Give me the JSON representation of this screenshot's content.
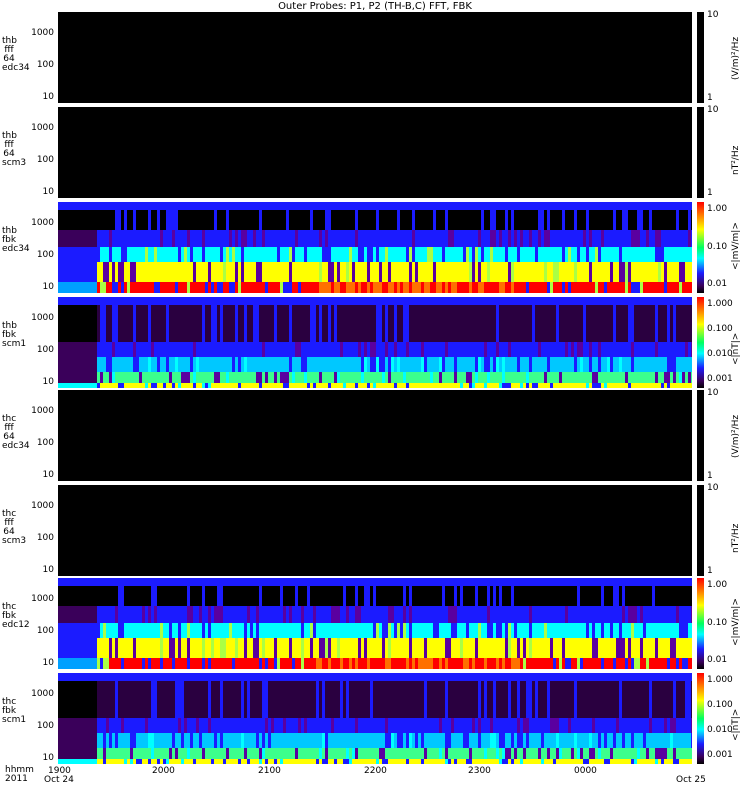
{
  "title": "Outer Probes: P1, P2 (TH-B,C) FFT, FBK",
  "footer": {
    "hhmm": "hhmm",
    "year": "2011"
  },
  "chart_data": [
    {
      "type": "heatmap",
      "panel_label": [
        "thb",
        "fff",
        "64",
        "edc34"
      ],
      "y_ticks": [
        "1000",
        "100",
        "10"
      ],
      "cbar_ticks": [
        "10",
        "1"
      ],
      "cbar_label": "(V/m)²/Hz",
      "empty": true
    },
    {
      "type": "heatmap",
      "panel_label": [
        "thb",
        "fff",
        "64",
        "scm3"
      ],
      "y_ticks": [
        "1000",
        "100",
        "10"
      ],
      "cbar_ticks": [
        "10",
        "1"
      ],
      "cbar_label": "nT²/Hz",
      "empty": true
    },
    {
      "type": "heatmap",
      "panel_label": [
        "thb",
        "fbk",
        "edc34"
      ],
      "y_ticks": [
        "1000",
        "100",
        "10"
      ],
      "cbar_ticks": [
        "1.00",
        "0.10",
        "0.01"
      ],
      "cbar_label": "<|mV/m|>",
      "empty": false
    },
    {
      "type": "heatmap",
      "panel_label": [
        "thb",
        "fbk",
        "scm1"
      ],
      "y_ticks": [
        "1000",
        "100",
        "10"
      ],
      "cbar_ticks": [
        "1.000",
        "0.100",
        "0.010",
        "0.001"
      ],
      "cbar_label": "<|nT|>",
      "empty": false
    },
    {
      "type": "heatmap",
      "panel_label": [
        "thc",
        "fff",
        "64",
        "edc34"
      ],
      "y_ticks": [
        "1000",
        "100",
        "10"
      ],
      "cbar_ticks": [
        "10",
        "1"
      ],
      "cbar_label": "(V/m)²/Hz",
      "empty": true
    },
    {
      "type": "heatmap",
      "panel_label": [
        "thc",
        "fff",
        "64",
        "scm3"
      ],
      "y_ticks": [
        "1000",
        "100",
        "10"
      ],
      "cbar_ticks": [
        "10",
        "1"
      ],
      "cbar_label": "nT²/Hz",
      "empty": true
    },
    {
      "type": "heatmap",
      "panel_label": [
        "thc",
        "fbk",
        "edc12"
      ],
      "y_ticks": [
        "1000",
        "100",
        "10"
      ],
      "cbar_ticks": [
        "1.00",
        "0.10",
        "0.01"
      ],
      "cbar_label": "<|mV/m|>",
      "empty": false
    },
    {
      "type": "heatmap",
      "panel_label": [
        "thc",
        "fbk",
        "scm1"
      ],
      "y_ticks": [
        "1000",
        "100",
        "10"
      ],
      "cbar_ticks": [
        "1.000",
        "0.100",
        "0.010",
        "0.001"
      ],
      "cbar_label": "<|nT|>",
      "empty": false
    }
  ],
  "x_axis": {
    "ticks": [
      "1900",
      "1900",
      "2000",
      "2100",
      "2200",
      "2300",
      "0000"
    ],
    "dates": [
      "Oct 24",
      "Oct 25"
    ]
  },
  "colors": {
    "background": "#000000",
    "low": "#3a005a",
    "mid": "#1b1bff",
    "cyan": "#00ffff",
    "high": "#ffff00",
    "max": "#ff0000"
  }
}
